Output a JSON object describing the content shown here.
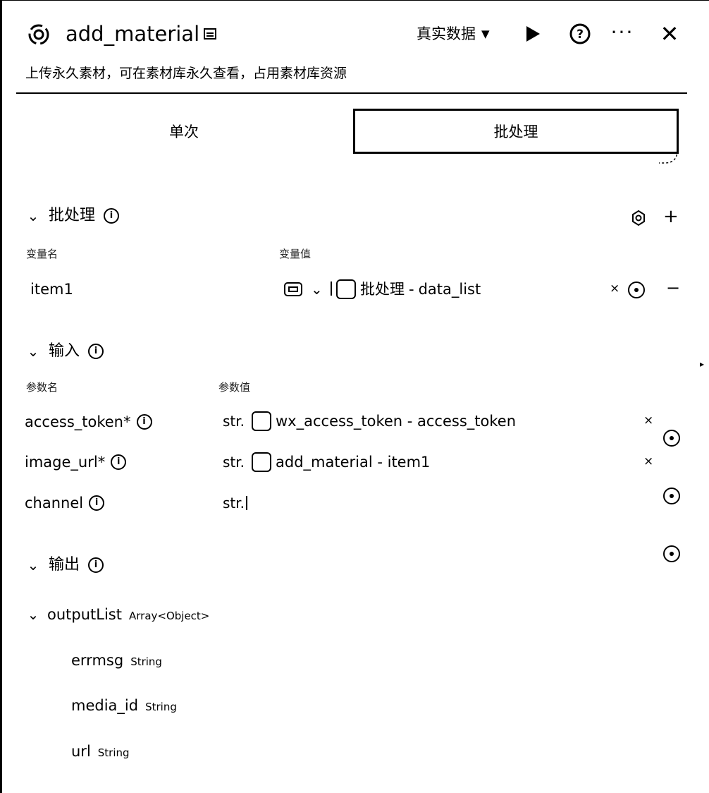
{
  "header": {
    "title": "add_material",
    "mode": "真实数据",
    "description": "上传永久素材，可在素材库永久查看，占用素材库资源"
  },
  "tabs": {
    "single": "单次",
    "batch": "批处理"
  },
  "batch_section": {
    "title": "批处理",
    "col_name": "变量名",
    "col_value": "变量值",
    "rows": [
      {
        "name": "item1",
        "ref_source": "批处理",
        "ref_field": "data_list",
        "separator": " - "
      }
    ]
  },
  "input_section": {
    "title": "输入",
    "col_name": "参数名",
    "col_value": "参数值",
    "rows": [
      {
        "name": "access_token",
        "required": "*",
        "type": "str.",
        "value": "wx_access_token - access_token"
      },
      {
        "name": "image_url",
        "required": "*",
        "type": "str.",
        "value": "add_material - item1"
      },
      {
        "name": "channel",
        "required": "",
        "type": "str.",
        "value": ""
      }
    ]
  },
  "output_section": {
    "title": "输出",
    "list": {
      "name": "outputList",
      "type": "Array<Object>"
    },
    "fields": [
      {
        "name": "errmsg",
        "type": "String"
      },
      {
        "name": "media_id",
        "type": "String"
      },
      {
        "name": "url",
        "type": "String"
      }
    ]
  }
}
